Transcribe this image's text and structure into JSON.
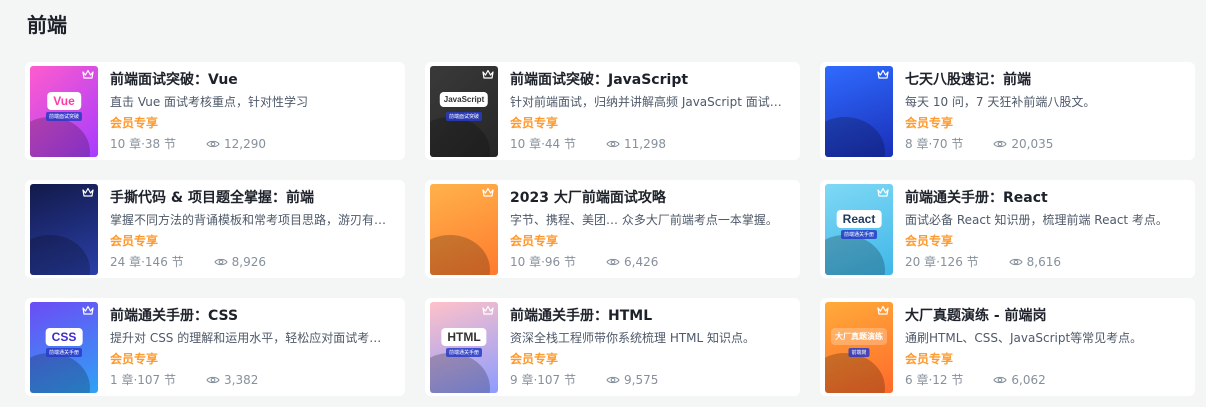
{
  "section": {
    "title": "前端"
  },
  "meta_sep": " · ",
  "courses": [
    {
      "title": "前端面试突破：Vue",
      "desc": "直击 Vue 面试考核重点，针对性学习",
      "vip": "会员专享",
      "chapters": "10 章",
      "sections": "38 节",
      "views": "12,290",
      "cover": {
        "bg": "linear-gradient(135deg,#ff5ccd,#a63cff)",
        "badge": "Vue",
        "tag": "前端面试突破",
        "badge_color": "#ff3aa6"
      }
    },
    {
      "title": "前端面试突破：JavaScript",
      "desc": "针对前端面试，归纳并讲解高频 JavaScript 面试题，",
      "vip": "会员专享",
      "chapters": "10 章",
      "sections": "44 节",
      "views": "11,298",
      "cover": {
        "bg": "linear-gradient(135deg,#3a3a3a,#262626)",
        "badge": "JavaScript",
        "tag": "前端面试突破",
        "badge_color": "#333"
      }
    },
    {
      "title": "七天八股速记：前端",
      "desc": "每天 10 问，7 天狂补前端八股文。",
      "vip": "会员专享",
      "chapters": "8 章",
      "sections": "70 节",
      "views": "20,035",
      "cover": {
        "bg": "linear-gradient(160deg,#2f6bff,#1a2fb8)",
        "badge": "",
        "tag": "",
        "badge_color": "#333"
      }
    },
    {
      "title": "手撕代码 & 项目题全掌握：前端",
      "desc": "掌握不同方法的背诵模板和常考项目思路，游刃有余地应对",
      "vip": "会员专享",
      "chapters": "24 章",
      "sections": "146 节",
      "views": "8,926",
      "cover": {
        "bg": "linear-gradient(160deg,#121a4a,#2a3fa8)",
        "badge": "",
        "tag": "",
        "badge_color": "#333"
      }
    },
    {
      "title": "2023 大厂前端面试攻略",
      "desc": "字节、携程、美团… 众多大厂前端考点一本掌握。",
      "vip": "会员专享",
      "chapters": "10 章",
      "sections": "96 节",
      "views": "6,426",
      "cover": {
        "bg": "linear-gradient(160deg,#ffb24a,#ff7a2e)",
        "badge": "",
        "tag": "",
        "badge_color": "#333"
      }
    },
    {
      "title": "前端通关手册：React",
      "desc": "面试必备 React 知识册，梳理前端 React 考点。",
      "vip": "会员专享",
      "chapters": "20 章",
      "sections": "126 节",
      "views": "8,616",
      "cover": {
        "bg": "linear-gradient(160deg,#7fd8f5,#3fb7e8)",
        "badge": "React",
        "tag": "前端通关手册",
        "badge_color": "#1e3a5f"
      }
    },
    {
      "title": "前端通关手册：CSS",
      "desc": "提升对 CSS 的理解和运用水平，轻松应对面试考核。",
      "vip": "会员专享",
      "chapters": "1 章",
      "sections": "107 节",
      "views": "3,382",
      "cover": {
        "bg": "linear-gradient(160deg,#6c4cf5,#2fa2f5)",
        "badge": "CSS",
        "tag": "前端通关手册",
        "badge_color": "#3b2cc8"
      }
    },
    {
      "title": "前端通关手册：HTML",
      "desc": "资深全栈工程师带你系统梳理 HTML 知识点。",
      "vip": "会员专享",
      "chapters": "9 章",
      "sections": "107 节",
      "views": "9,575",
      "cover": {
        "bg": "linear-gradient(160deg,#ffc1c8,#8c9cff)",
        "badge": "HTML",
        "tag": "前端通关手册",
        "badge_color": "#333"
      }
    },
    {
      "title": "大厂真题演练 - 前端岗",
      "desc": "通刷HTML、CSS、JavaScript等常见考点。",
      "vip": "会员专享",
      "chapters": "6 章",
      "sections": "12 节",
      "views": "6,062",
      "cover": {
        "bg": "linear-gradient(160deg,#ffab3a,#ff6a2a)",
        "badge": "大厂真题演练",
        "tag": "前端岗",
        "badge_color": "#fff"
      }
    }
  ],
  "icons": {
    "crown": "crown-icon",
    "eye": "eye-icon"
  },
  "colors": {
    "vip": "#ff9a2e",
    "card_bg": "#ffffff",
    "page_bg": "#f4f5f5"
  }
}
